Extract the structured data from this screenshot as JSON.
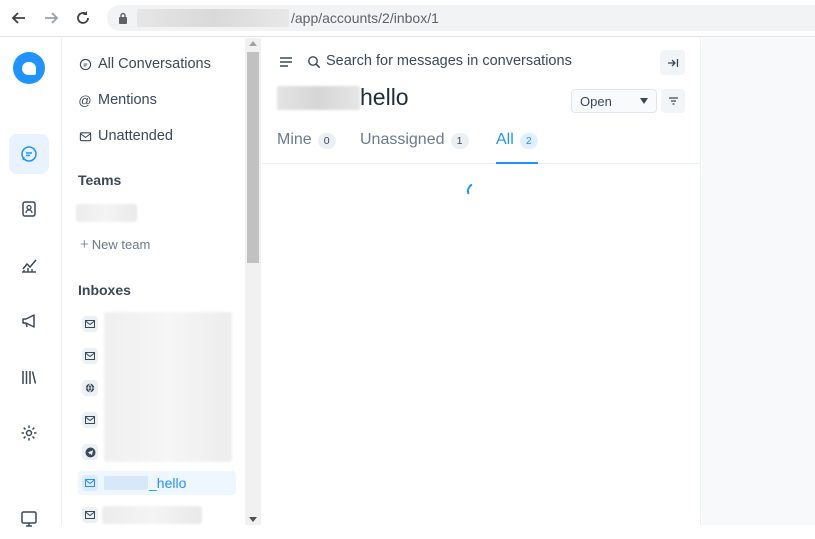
{
  "browser": {
    "url_path": "/app/accounts/2/inbox/1",
    "icons": [
      "back-arrow-icon",
      "forward-arrow-icon",
      "reload-icon",
      "lock-icon"
    ]
  },
  "rail": {
    "icons": [
      "logo",
      "conversations-icon",
      "contacts-icon",
      "reports-icon",
      "campaigns-icon",
      "library-icon",
      "settings-icon",
      "help-icon"
    ]
  },
  "sidebar": {
    "nav": [
      {
        "label": "All Conversations",
        "icon": "chat-bubble-icon"
      },
      {
        "label": "Mentions",
        "icon": "at-icon"
      },
      {
        "label": "Unattended",
        "icon": "mail-clock-icon"
      }
    ],
    "teams_title": "Teams",
    "new_team_label": "New team",
    "inboxes_title": "Inboxes",
    "active_inbox_suffix": "_hello"
  },
  "conversation_list": {
    "search_placeholder": "Search for messages in conversations",
    "title_suffix": "hello",
    "status_value": "Open",
    "tabs": [
      {
        "label": "Mine",
        "count": "0"
      },
      {
        "label": "Unassigned",
        "count": "1"
      },
      {
        "label": "All",
        "count": "2"
      }
    ]
  },
  "colors": {
    "accent": "#1f93ff",
    "text": "#3c4858",
    "muted": "#6b7a8c"
  }
}
